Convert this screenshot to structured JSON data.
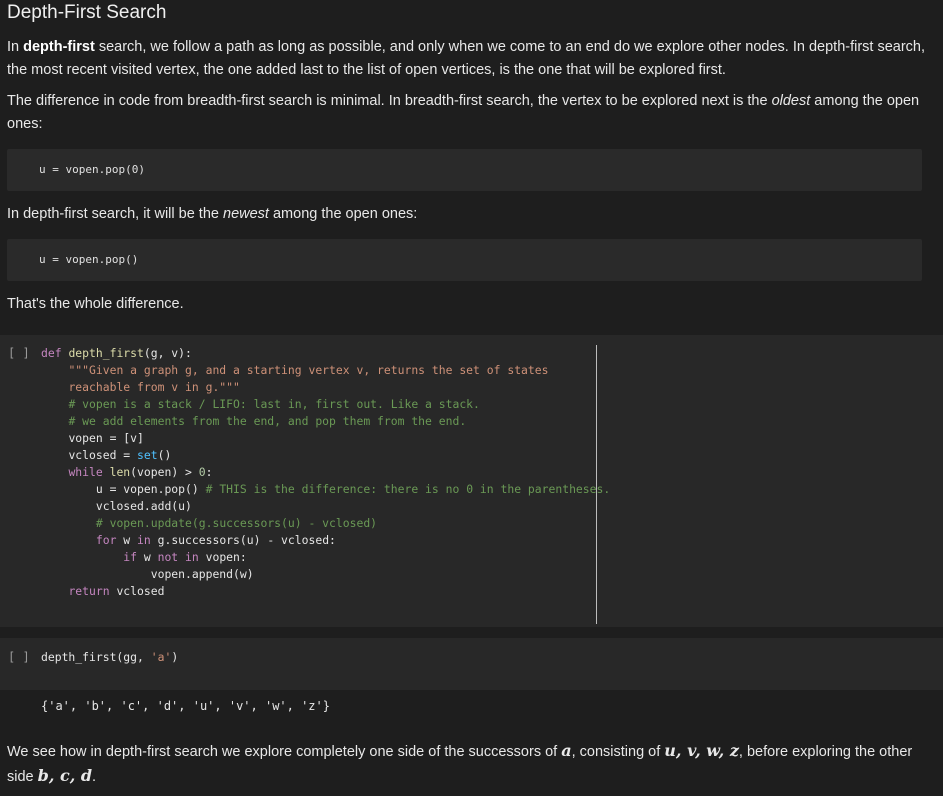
{
  "heading": "Depth-First Search",
  "para1": {
    "pre": "In ",
    "bold": "depth-first",
    "post": " search, we follow a path as long as possible, and only when we come to an end do we explore other nodes. In depth-first search, the most recent visited vertex, the one added last to the list of open vertices, is the one that will be explored first."
  },
  "para2": {
    "pre": "The difference in code from breadth-first search is minimal. In breadth-first search, the vertex to be explored next is the ",
    "italic": "oldest",
    "post": " among the open ones:"
  },
  "code1": "u = vopen.pop(0)",
  "para3": {
    "pre": "In depth-first search, it will be the ",
    "italic": "newest",
    "post": " among the open ones:"
  },
  "code2": "u = vopen.pop()",
  "para4": "That's the whole difference.",
  "cell1": {
    "prompt": "[ ]",
    "lines": {
      "l1a": "def",
      "l1b": "depth_first",
      "l1c": "(g, v):",
      "l2": "\"\"\"Given a graph g, and a starting vertex v, returns the set of states",
      "l3": "reachable from v in g.\"\"\"",
      "l4": "# vopen is a stack / LIFO: last in, first out. Like a stack.",
      "l5": "# we add elements from the end, and pop them from the end.",
      "l6": "vopen = [v]",
      "l7a": "vclosed = ",
      "l7b": "set",
      "l7c": "()",
      "l8a": "while",
      "l8b": " len",
      "l8c": "(vopen) > ",
      "l8d": "0",
      "l8e": ":",
      "l9a": "u = vopen.pop() ",
      "l9b": "# THIS is the difference: there is no 0 in the parentheses.",
      "l10": "vclosed.add(u)",
      "l11": "# vopen.update(g.successors(u) - vclosed)",
      "l12a": "for",
      "l12b": " w ",
      "l12c": "in",
      "l12d": " g.successors(u) - vclosed:",
      "l13a": "if",
      "l13b": " w ",
      "l13c": "not in",
      "l13d": " vopen:",
      "l14": "vopen.append(w)",
      "l15a": "return",
      "l15b": " vclosed"
    }
  },
  "cell2": {
    "prompt": "[ ]",
    "code_a": "depth_first(gg, ",
    "code_b": "'a'",
    "code_c": ")"
  },
  "output": "{'a', 'b', 'c', 'd', 'u', 'v', 'w', 'z'}",
  "para5": {
    "pre": "We see how in depth-first search we explore completely one side of the successors of ",
    "m1": "a",
    "mid": ", consisting of ",
    "m2": "u, v, w, z",
    "mid2": ", before exploring the other side ",
    "m3": "b, c, d",
    "post": "."
  }
}
